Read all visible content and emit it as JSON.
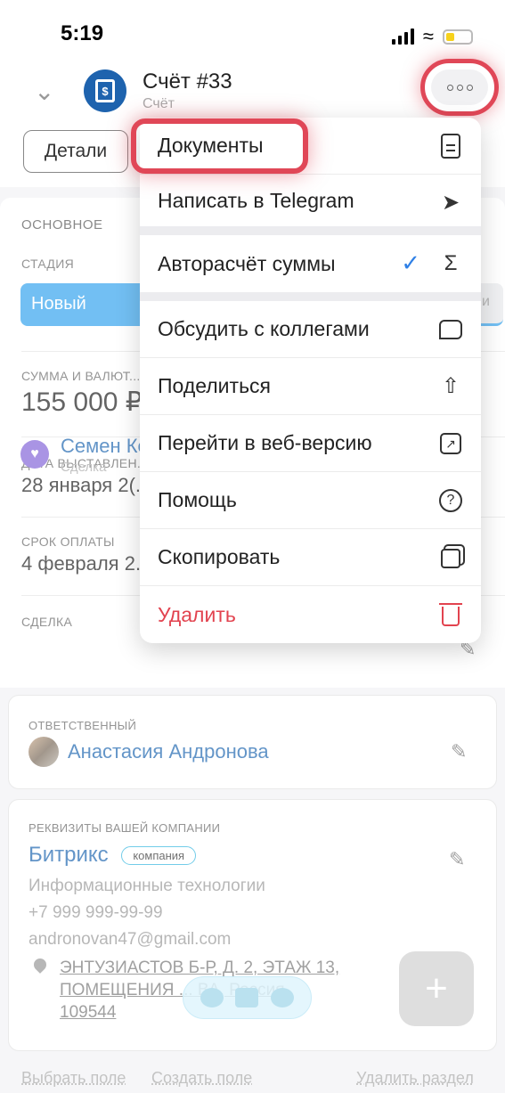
{
  "status_bar": {
    "time": "5:19"
  },
  "header": {
    "title": "Счёт #33",
    "subtitle": "Счёт",
    "tab_details": "Детали"
  },
  "main": {
    "section_title": "ОСНОВНОЕ",
    "stage_label": "СТАДИЯ",
    "stage_value": "Новый",
    "stage_right_fragment": "и",
    "sum_label": "СУММА И ВАЛЮТ...",
    "sum_value": "155 000 ₽",
    "date_issued_label": "ДАТА ВЫСТАВЛЕН...",
    "date_issued_value": "28 января 2(...)",
    "due_label": "СРОК ОПЛАТЫ",
    "due_value": "4 февраля 2...",
    "deal_label": "СДЕЛКА",
    "deal_name": "Семен Королев",
    "deal_sub": "Сделка"
  },
  "responsible": {
    "label": "ОТВЕТСТВЕННЫЙ",
    "name": "Анастасия Андронова"
  },
  "company": {
    "label": "РЕКВИЗИТЫ ВАШЕЙ КОМПАНИИ",
    "name": "Битрикс",
    "badge": "компания",
    "industry": "Информационные технологии",
    "phone": "+7 999 999-99-99",
    "email": "andronovan47@gmail.com",
    "address_line1": "ЭНТУЗИАСТОВ Б-Р, Д. 2, ЭТАЖ 13,",
    "address_line2": "ПОМЕЩЕНИЯ ... ВА, Россия",
    "address_line3": "109544"
  },
  "bottom_links": {
    "select_field": "Выбрать поле",
    "create_field": "Создать поле",
    "delete_section": "Удалить раздел"
  },
  "menu": {
    "items": [
      {
        "label": "Документы",
        "icon": "document-icon"
      },
      {
        "label": "Написать в Telegram",
        "icon": "paper-plane-icon"
      },
      {
        "label": "Авторасчёт суммы",
        "icon": "sigma-icon",
        "checked": true
      },
      {
        "label": "Обсудить с коллегами",
        "icon": "chat-bubble-icon"
      },
      {
        "label": "Поделиться",
        "icon": "share-icon"
      },
      {
        "label": "Перейти в веб-версию",
        "icon": "external-link-icon"
      },
      {
        "label": "Помощь",
        "icon": "help-icon"
      },
      {
        "label": "Скопировать",
        "icon": "copy-icon"
      },
      {
        "label": "Удалить",
        "icon": "trash-icon",
        "destructive": true
      }
    ]
  },
  "colors": {
    "accent_blue": "#2067b0",
    "stage_blue": "#35a4ee",
    "highlight_red": "#e04757",
    "danger_red": "#e2434f"
  }
}
